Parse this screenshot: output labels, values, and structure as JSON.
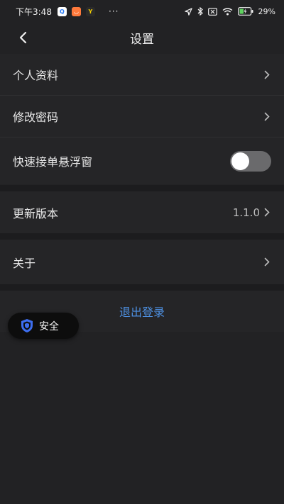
{
  "status_bar": {
    "time": "下午3:48",
    "battery": "29%",
    "more": "···"
  },
  "header": {
    "title": "设置"
  },
  "settings": {
    "profile_label": "个人资料",
    "password_label": "修改密码",
    "floating_window_label": "快速接单悬浮窗",
    "floating_window_enabled": false,
    "update_label": "更新版本",
    "version": "1.1.0",
    "about_label": "关于"
  },
  "logout_label": "退出登录",
  "safety_badge": {
    "label": "安全"
  },
  "colors": {
    "background": "#222224",
    "row": "#252527",
    "accent": "#4d8fe0",
    "shield": "#3d6ef0"
  }
}
